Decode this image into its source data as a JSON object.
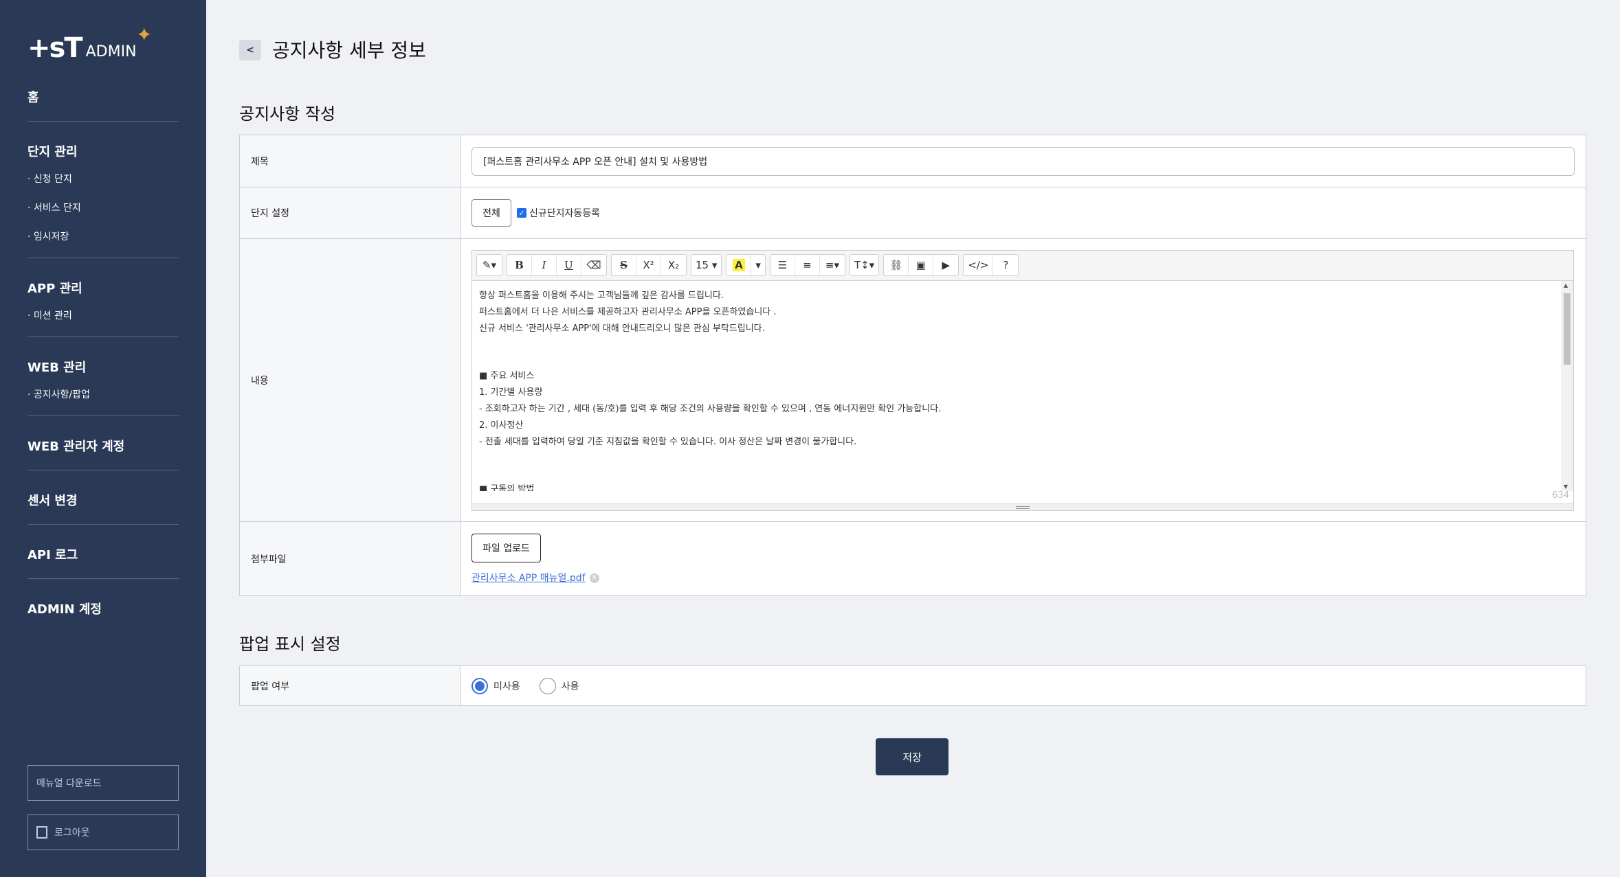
{
  "sidebar": {
    "logo_mark": "+sT",
    "logo_text": "ADMIN",
    "home": "홈",
    "groups": [
      {
        "title": "단지 관리",
        "items": [
          "· 신청 단지",
          "· 서비스 단지",
          "· 임시저장"
        ]
      },
      {
        "title": "APP 관리",
        "items": [
          "· 미션 관리"
        ]
      },
      {
        "title": "WEB 관리",
        "items": [
          "· 공지사항/팝업"
        ]
      },
      {
        "title": "WEB 관리자 계정",
        "items": []
      },
      {
        "title": "센서 변경",
        "items": []
      },
      {
        "title": "API 로그",
        "items": []
      },
      {
        "title": "ADMIN 계정",
        "items": []
      }
    ],
    "manual_download": "매뉴얼 다운로드",
    "logout": "로그아웃"
  },
  "header": {
    "back_label": "<",
    "title": "공지사항 세부 정보"
  },
  "notice_section": {
    "title": "공지사항 작성",
    "subject_label": "제목",
    "subject_value": "[퍼스트홈 관리사무소 APP 오픈 안내] 설치 및 사용방법",
    "complex_label": "단지 설정",
    "complex_button": "전체",
    "auto_register_label": "신규단지자동등록",
    "content_label": "내용",
    "attachment_label": "첨부파일",
    "upload_button": "파일 업로드",
    "attached_file": "관리사무소 APP 매뉴얼.pdf"
  },
  "editor": {
    "font_size": "15",
    "char_count": "634",
    "lines": [
      "항상 퍼스트홈을 이용해 주시는 고객님들께 깊은 감사를 드립니다.",
      "퍼스트홈에서 더 나은 서비스를 제공하고자 관리사무소 APP을 오픈하였습니다 .",
      "신규 서비스 '관리사무소 APP'에 대해 안내드리오니 많은 관심 부탁드립니다.",
      "",
      "■ 주요 서비스",
      "1. 기간별 사용량",
      " - 조회하고자 하는 기간 , 세대 (동/호)를 입력 후 해당 조건의 사용량을 확인할 수 있으며 , 연동 에너지원만 확인 가능합니다.",
      "2. 이사정산",
      " - 전출 세대를 입력하여 당일 기준 지침값을 확인할 수 있습니다. 이사 정산은 날짜 변경이 불가합니다.",
      "",
      "■ 구동의 방법"
    ]
  },
  "popup_section": {
    "title": "팝업 표시 설정",
    "popup_label": "팝업 여부",
    "options": [
      "미사용",
      "사용"
    ],
    "selected": "미사용"
  },
  "save_button": "저장",
  "colors": {
    "sidebar_bg": "#2a3956",
    "accent": "#3b6fd6",
    "page_bg": "#f0f1f4"
  }
}
